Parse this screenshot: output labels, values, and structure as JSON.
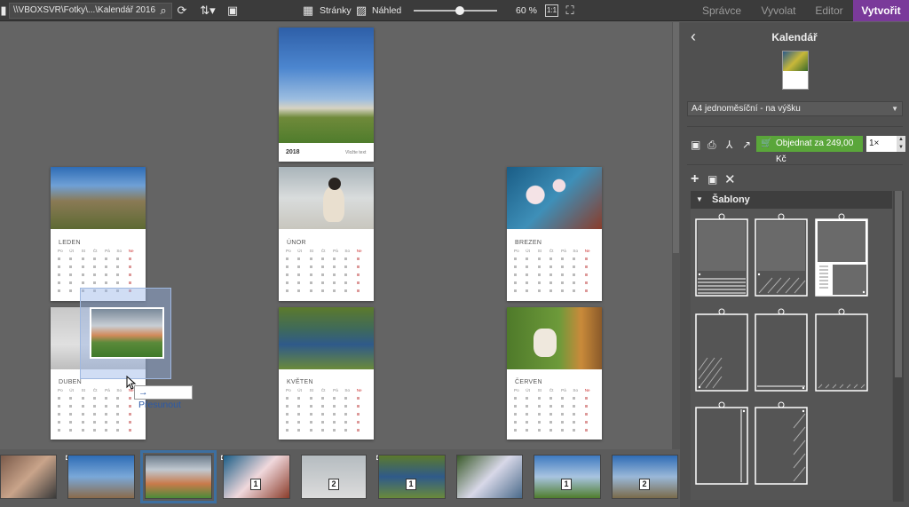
{
  "toolbar": {
    "path": "\\\\VBOXSVR\\Fotky\\...\\Kalendář 2016",
    "view_pages_label": "Stránky",
    "view_preview_label": "Náhled",
    "zoom": "60 %",
    "zoom_fraction": 0.55,
    "fit_label": "1:1"
  },
  "modes": [
    {
      "label": "Správce"
    },
    {
      "label": "Vyvolat"
    },
    {
      "label": "Editor"
    },
    {
      "label": "Vytvořit"
    }
  ],
  "calendar": {
    "cover": {
      "year": "2018",
      "text": "Vložte text"
    },
    "months": [
      {
        "name": "LEDEN"
      },
      {
        "name": "ÚNOR"
      },
      {
        "name": "BREZEN"
      },
      {
        "name": "DUBEN"
      },
      {
        "name": "KVĚTEN"
      },
      {
        "name": "ČERVEN"
      }
    ],
    "weekdays": [
      "Po",
      "Út",
      "St",
      "Čt",
      "Pá",
      "So",
      "Ne"
    ]
  },
  "drag": {
    "tooltip": "Přesunout"
  },
  "filmstrip": {
    "badges": [
      "1",
      "2",
      "1",
      "1",
      "2"
    ]
  },
  "panel": {
    "title": "Kalendář",
    "size_option": "A4 jednoměsíční - na výšku",
    "order_label": "Objednat za 249,00 Kč",
    "qty": "1×",
    "templates_label": "Šablony"
  },
  "colors": {
    "accent": "#7a3a9a",
    "order": "#5aa63a",
    "selection": "#3d6fa0"
  }
}
